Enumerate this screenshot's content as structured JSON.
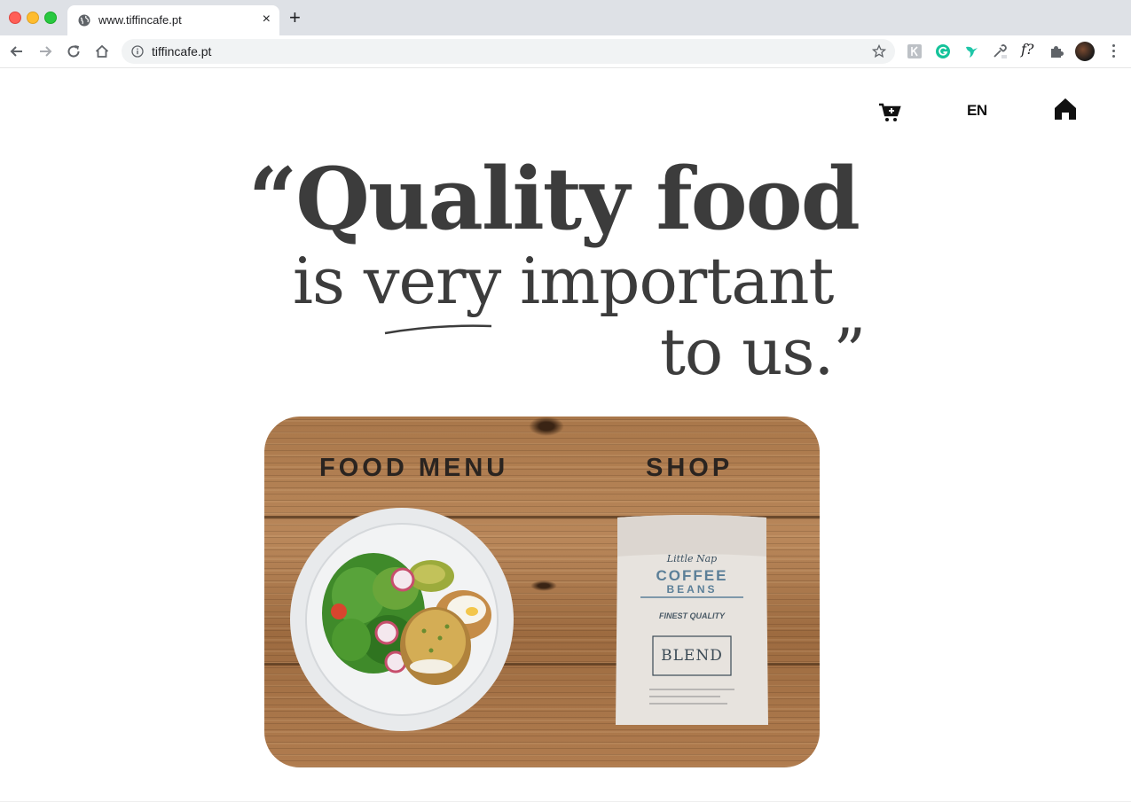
{
  "browser": {
    "tab_title": "www.tiffincafe.pt",
    "tab_close": "×",
    "new_tab": "+",
    "url": "tiffincafe.pt",
    "extension_f": "f?"
  },
  "site": {
    "language": "EN",
    "quote": {
      "line1": "“Quality food",
      "line2": "is very important",
      "line3": "to us.”"
    },
    "hero": {
      "food_menu_label": "FOOD MENU",
      "shop_label": "SHOP",
      "bag": {
        "brand": "Little Nap",
        "title1": "COFFEE",
        "title2": "BEANS",
        "quality": "FINEST QUALITY",
        "blend": "BLEND"
      }
    }
  }
}
